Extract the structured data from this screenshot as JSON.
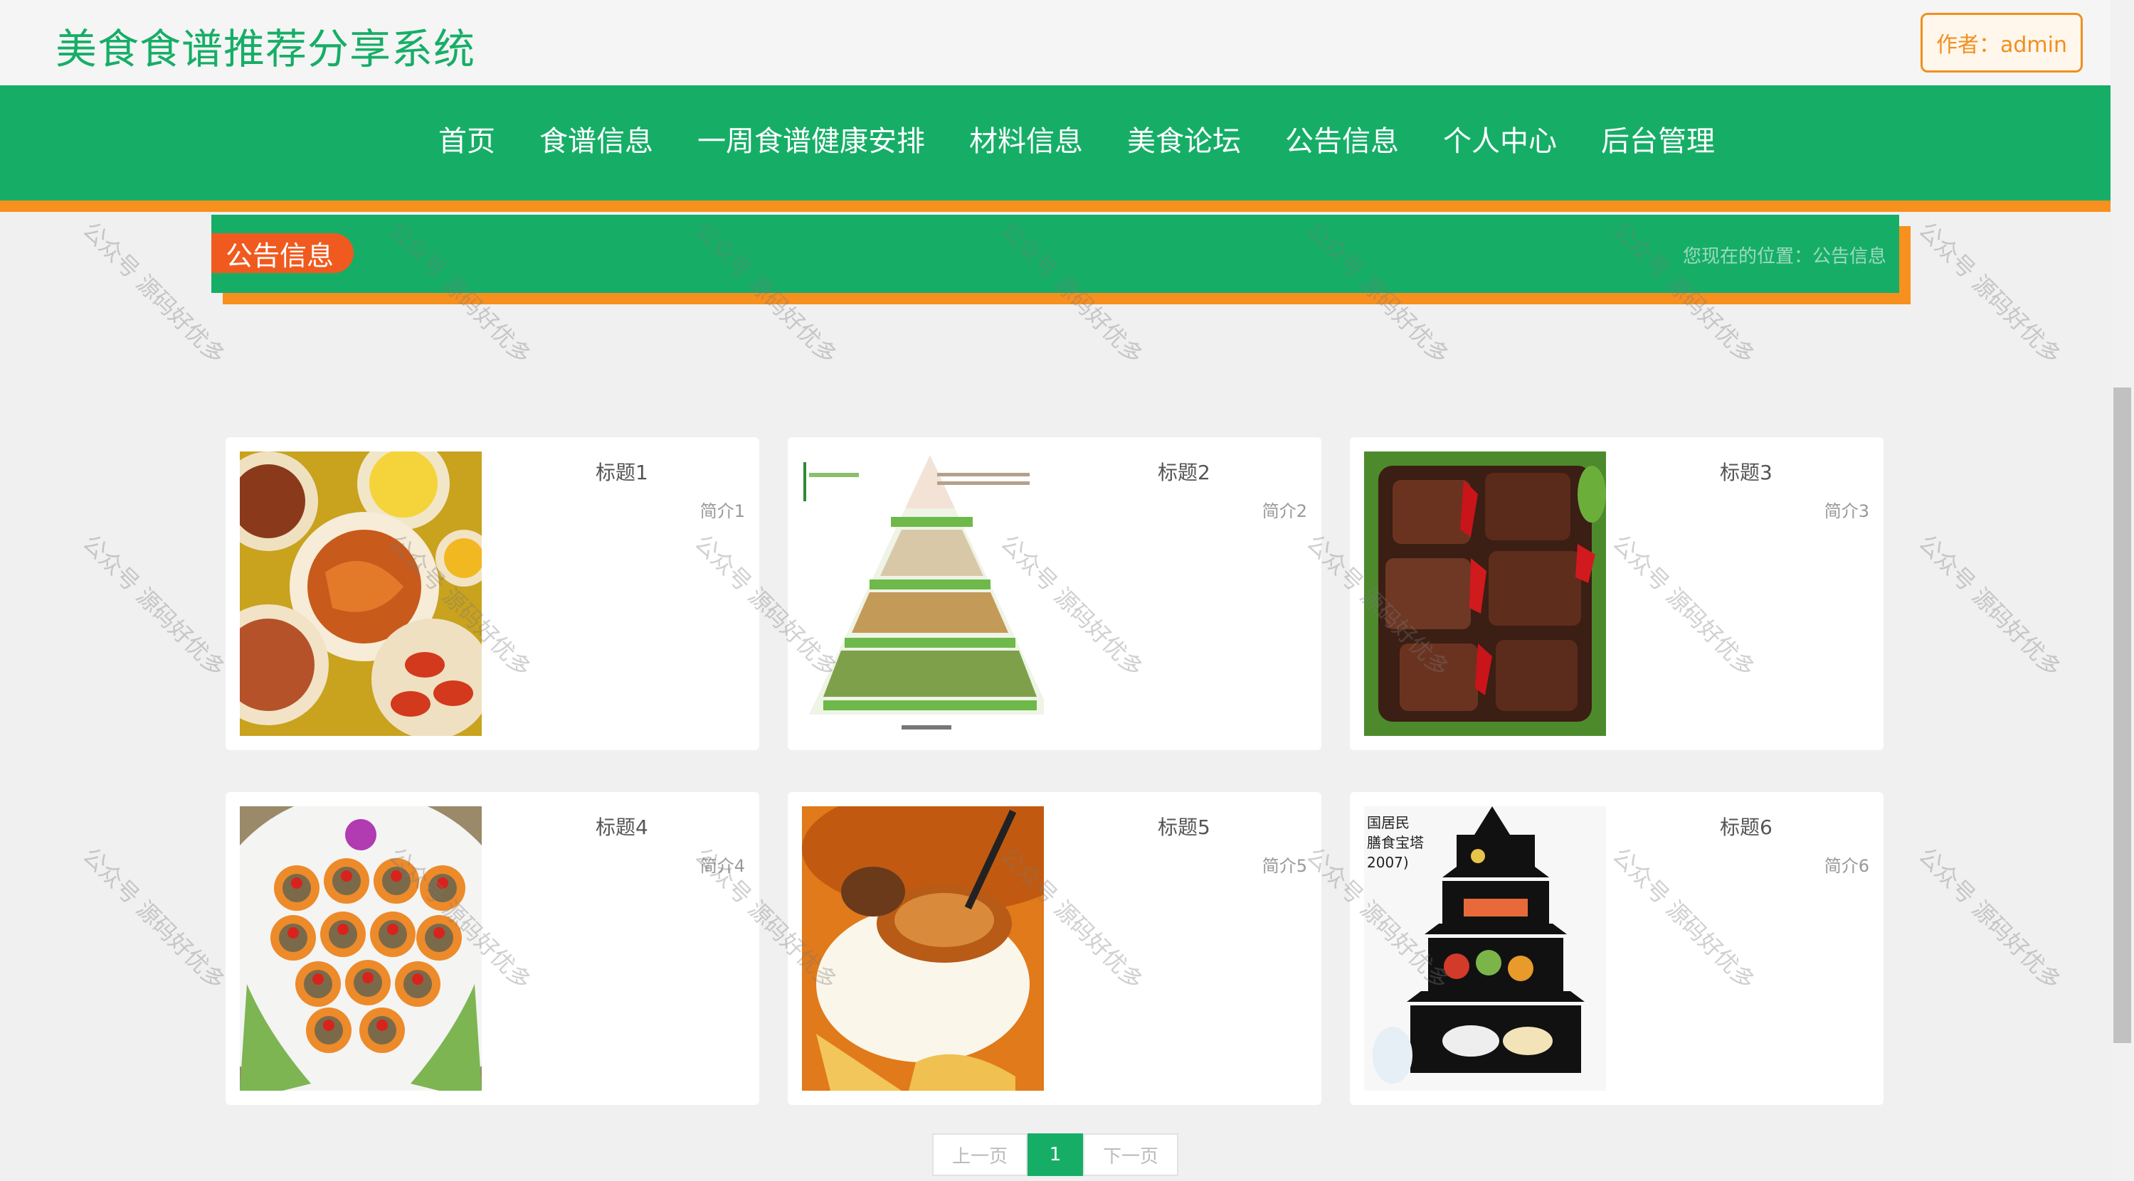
{
  "header": {
    "site_title": "美食食谱推荐分享系统",
    "author_label": "作者：admin"
  },
  "nav": {
    "items": [
      "首页",
      "食谱信息",
      "一周食谱健康安排",
      "材料信息",
      "美食论坛",
      "公告信息",
      "个人中心",
      "后台管理"
    ]
  },
  "section": {
    "tag": "公告信息",
    "breadcrumb": "您现在的位置：公告信息"
  },
  "cards": [
    {
      "title": "标题1",
      "intro": "简介1",
      "image": "food-platter-image"
    },
    {
      "title": "标题2",
      "intro": "简介2",
      "image": "food-pyramid-image"
    },
    {
      "title": "标题3",
      "intro": "简介3",
      "image": "grilled-meat-image"
    },
    {
      "title": "标题4",
      "intro": "简介4",
      "image": "carrot-cups-image"
    },
    {
      "title": "标题5",
      "intro": "简介5",
      "image": "abalone-rice-image"
    },
    {
      "title": "标题6",
      "intro": "简介6",
      "image": "diet-pagoda-image"
    }
  ],
  "pagination": {
    "prev": "上一页",
    "current": "1",
    "next": "下一页"
  },
  "watermark": "公众号 源码好优多",
  "colors": {
    "brand_green": "#16ae67",
    "accent_orange": "#f7901f",
    "tag_red_orange": "#f05a1f"
  }
}
